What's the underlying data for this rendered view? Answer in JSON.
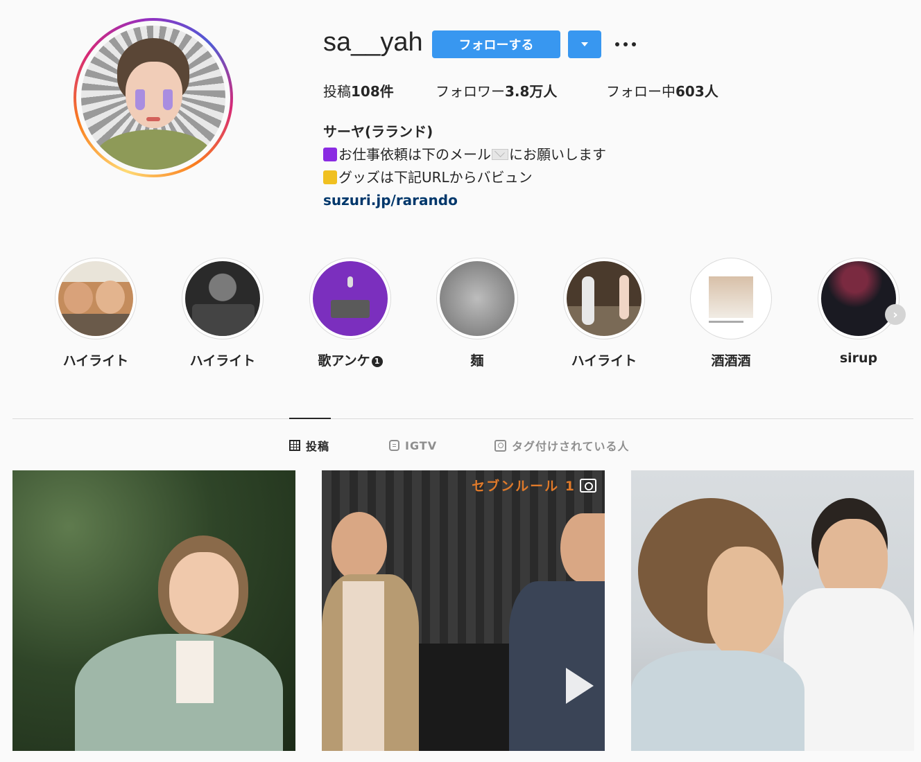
{
  "profile": {
    "username": "sa__yah",
    "follow_label": "フォローする",
    "stats": {
      "posts_label": "投稿",
      "posts_count": "108件",
      "followers_label": "フォロワー",
      "followers_count": "3.8万人",
      "following_label": "フォロー中",
      "following_count": "603人"
    },
    "bio": {
      "name": "サーヤ(ラランド)",
      "line1_a": "お仕事依頼は下のメール",
      "line1_b": "にお願いします",
      "line2": "グッズは下記URLからバビュン",
      "link": "suzuri.jp/rarando"
    }
  },
  "highlights": [
    {
      "label": "ハイライト"
    },
    {
      "label": "ハイライト"
    },
    {
      "label": "歌アンケ",
      "badge": "1"
    },
    {
      "label": "麺"
    },
    {
      "label": "ハイライト"
    },
    {
      "label": "酒酒酒"
    },
    {
      "label": "sirup"
    }
  ],
  "tabs": {
    "posts": "投稿",
    "igtv": "IGTV",
    "tagged": "タグ付けされている人"
  },
  "posts": {
    "post2_overlay": "セブンルール 1"
  },
  "colors": {
    "accent": "#3897f0",
    "link": "#00376b",
    "badge_purple": "#8a2be2",
    "badge_yellow": "#f0c020"
  }
}
